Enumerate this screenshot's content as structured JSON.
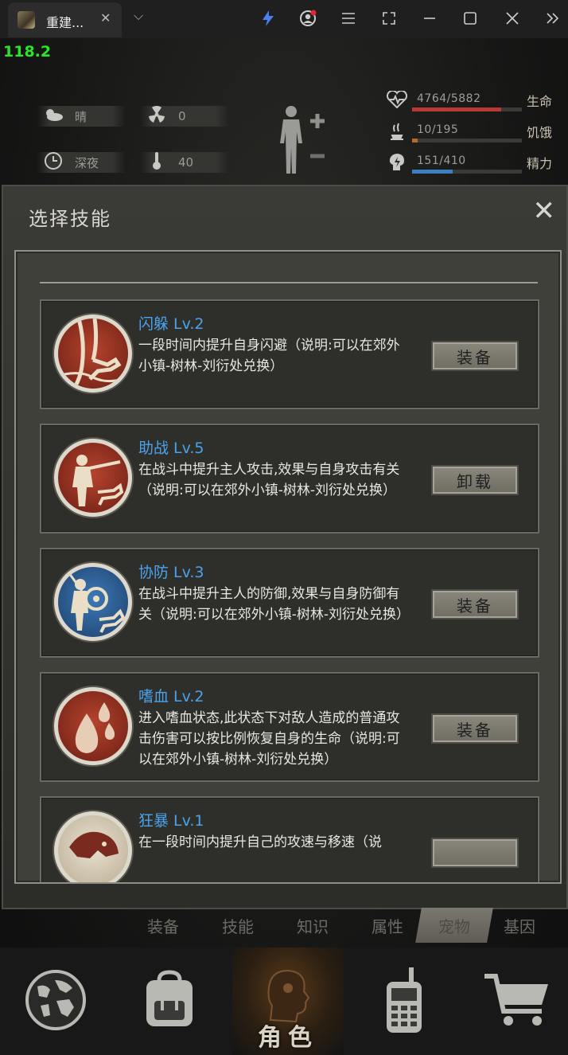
{
  "browser": {
    "tab_title": "重建...",
    "tab_close": "✕",
    "tab_menu": "⌵",
    "icons": [
      "lightning-icon",
      "profile-icon",
      "menu-icon",
      "screenshot-icon",
      "minimize-icon",
      "maximize-icon",
      "close-icon",
      "more-icon"
    ]
  },
  "fps": "118.2",
  "hud": {
    "weather": "晴",
    "radiation": "0",
    "time_of_day": "深夜",
    "temperature": "40",
    "stats": [
      {
        "label": "生命",
        "value": "4764/5882",
        "ratio": 0.81,
        "color": "#b93a34",
        "icon": "heartbeat-icon"
      },
      {
        "label": "饥饿",
        "value": "10/195",
        "ratio": 0.05,
        "color": "#b46b2a",
        "icon": "food-icon"
      },
      {
        "label": "精力",
        "value": "151/410",
        "ratio": 0.37,
        "color": "#3d7fc4",
        "icon": "energy-icon"
      }
    ]
  },
  "modal": {
    "title": "选择技能",
    "close": "✕",
    "skills": [
      {
        "name": "闪躲 Lv.2",
        "desc": "一段时间内提升自身闪避（说明:可以在郊外小镇-树林-刘衍处兑换）",
        "button": "装备",
        "icon": "dodge-icon"
      },
      {
        "name": "助战 Lv.5",
        "desc": "在战斗中提升主人攻击,效果与自身攻击有关（说明:可以在郊外小镇-树林-刘衍处兑换）",
        "button": "卸载",
        "icon": "assist-icon"
      },
      {
        "name": "协防 Lv.3",
        "desc": "在战斗中提升主人的防御,效果与自身防御有关（说明:可以在郊外小镇-树林-刘衍处兑换）",
        "button": "装备",
        "icon": "defense-icon"
      },
      {
        "name": "嗜血 Lv.2",
        "desc": "进入嗜血状态,此状态下对敌人造成的普通攻击伤害可以按比例恢复自身的生命（说明:可以在郊外小镇-树林-刘衍处兑换）",
        "button": "装备",
        "icon": "bloodlust-icon"
      },
      {
        "name": "狂暴 Lv.1",
        "desc": "在一段时间内提升自己的攻速与移速（说",
        "button": "",
        "icon": "berserk-icon"
      }
    ]
  },
  "subtabs": [
    "装备",
    "技能",
    "知识",
    "属性",
    "宠物",
    "基因"
  ],
  "active_subtab": "宠物",
  "nav": {
    "active_label": "角色",
    "items": [
      "globe-icon",
      "backpack-icon",
      "character-icon",
      "radio-icon",
      "cart-icon"
    ]
  }
}
